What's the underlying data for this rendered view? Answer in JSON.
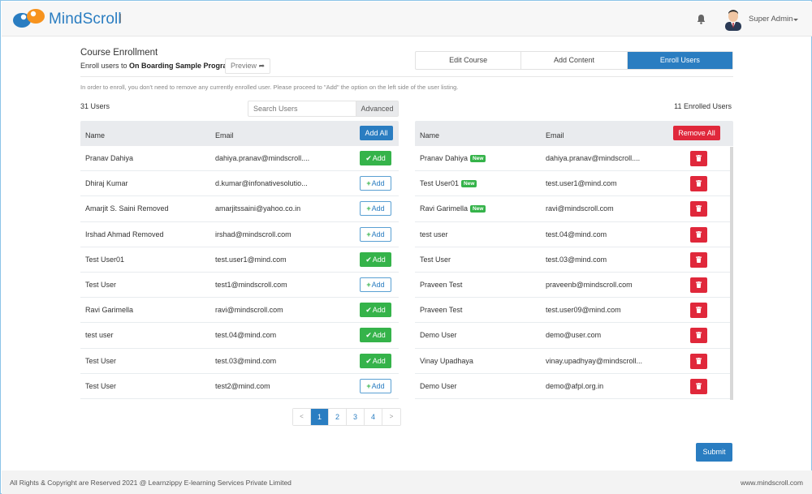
{
  "header": {
    "brand": "MindScroll",
    "user_name": "Super Admin",
    "colors": {
      "brand_blue": "#2a7dc1",
      "logo_orange": "#f7931e"
    }
  },
  "page": {
    "title": "Course Enrollment",
    "enroll_prefix": "Enroll users to ",
    "course_name": "On Boarding Sample Program",
    "preview_label": "Preview",
    "hint": "In order to enroll, you don't need to remove any currently enrolled user. Please proceed to \"Add\" the option on the left side of the user listing."
  },
  "tabs": [
    {
      "label": "Edit Course",
      "active": false
    },
    {
      "label": "Add Content",
      "active": false
    },
    {
      "label": "Enroll Users",
      "active": true
    }
  ],
  "users_panel": {
    "count_label": "31 Users",
    "search_placeholder": "Search Users",
    "search_value": "",
    "advanced_label": "Advanced",
    "col_name": "Name",
    "col_email": "Email",
    "add_all_label": "Add All",
    "add_label": "Add",
    "rows": [
      {
        "name": "Pranav Dahiya",
        "email": "dahiya.pranav@mindscroll....",
        "added": true
      },
      {
        "name": "Dhiraj Kumar",
        "email": "d.kumar@infonativesolutio...",
        "added": false
      },
      {
        "name": "Amarjit S. Saini  Removed",
        "email": "amarjitssaini@yahoo.co.in",
        "added": false
      },
      {
        "name": "Irshad Ahmad  Removed",
        "email": "irshad@mindscroll.com",
        "added": false
      },
      {
        "name": "Test User01",
        "email": "test.user1@mind.com",
        "added": true
      },
      {
        "name": "Test User",
        "email": "test1@mindscroll.com",
        "added": false
      },
      {
        "name": "Ravi Garimella",
        "email": "ravi@mindscroll.com",
        "added": true
      },
      {
        "name": "test user",
        "email": "test.04@mind.com",
        "added": true
      },
      {
        "name": "Test User",
        "email": "test.03@mind.com",
        "added": true
      },
      {
        "name": "Test User",
        "email": "test2@mind.com",
        "added": false
      }
    ]
  },
  "pagination": {
    "prev": "<",
    "pages": [
      "1",
      "2",
      "3",
      "4"
    ],
    "current": "1",
    "next": ">"
  },
  "enrolled_panel": {
    "count_label": "11 Enrolled Users",
    "col_name": "Name",
    "col_email": "Email",
    "remove_all_label": "Remove All",
    "new_badge": "New",
    "rows": [
      {
        "name": "Pranav Dahiya",
        "email": "dahiya.pranav@mindscroll....",
        "is_new": true
      },
      {
        "name": "Test User01",
        "email": "test.user1@mind.com",
        "is_new": true
      },
      {
        "name": "Ravi Garimella",
        "email": "ravi@mindscroll.com",
        "is_new": true
      },
      {
        "name": "test user",
        "email": "test.04@mind.com",
        "is_new": false
      },
      {
        "name": "Test User",
        "email": "test.03@mind.com",
        "is_new": false
      },
      {
        "name": "Praveen Test",
        "email": "praveenb@mindscroll.com",
        "is_new": false
      },
      {
        "name": "Praveen Test",
        "email": "test.user09@mind.com",
        "is_new": false
      },
      {
        "name": "Demo User",
        "email": "demo@user.com",
        "is_new": false
      },
      {
        "name": "Vinay Upadhaya",
        "email": "vinay.upadhyay@mindscroll...",
        "is_new": false
      },
      {
        "name": "Demo User",
        "email": "demo@afpl.org.in",
        "is_new": false
      }
    ]
  },
  "actions": {
    "submit_label": "Submit"
  },
  "footer": {
    "copyright": "All Rights & Copyright are Reserved 2021 @ Learnzippy E-learning Services Private Limited",
    "website": "www.mindscroll.com"
  }
}
